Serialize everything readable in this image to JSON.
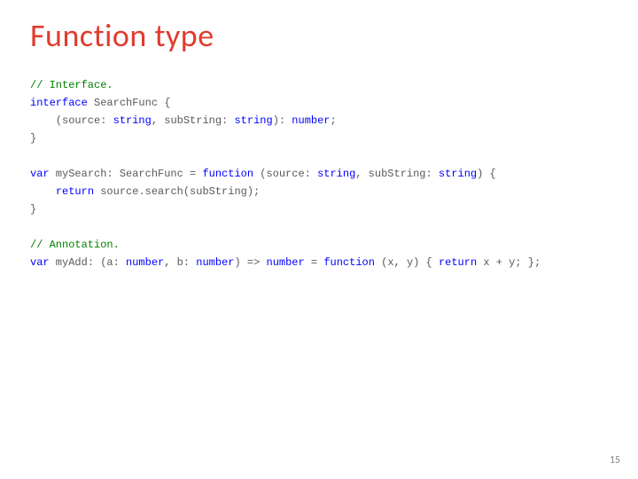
{
  "title": "Function type",
  "page_number": "15",
  "code": {
    "c1": "// Interface.",
    "kw_interface": "interface",
    "iface_name": " SearchFunc {",
    "sig_open": "    (source: ",
    "t_string1": "string",
    "sig_mid1": ", subString: ",
    "t_string2": "string",
    "sig_mid2": "): ",
    "t_number1": "number",
    "sig_end": ";",
    "brace1": "}",
    "kw_var1": "var",
    "decl1_a": " mySearch: SearchFunc = ",
    "kw_function1": "function",
    "decl1_b": " (source: ",
    "t_string3": "string",
    "decl1_c": ", subString: ",
    "t_string4": "string",
    "decl1_d": ") {",
    "ret_indent": "    ",
    "kw_return1": "return",
    "ret_body": " source.search(subString);",
    "brace2": "}",
    "c2": "// Annotation.",
    "kw_var2": "var",
    "decl2_a": " myAdd: (a: ",
    "t_number2": "number",
    "decl2_b": ", b: ",
    "t_number3": "number",
    "decl2_c": ") => ",
    "t_number4": "number",
    "decl2_d": " = ",
    "kw_function2": "function",
    "decl2_e": " (x, y) { ",
    "kw_return2": "return",
    "decl2_f": " x + y; };"
  }
}
